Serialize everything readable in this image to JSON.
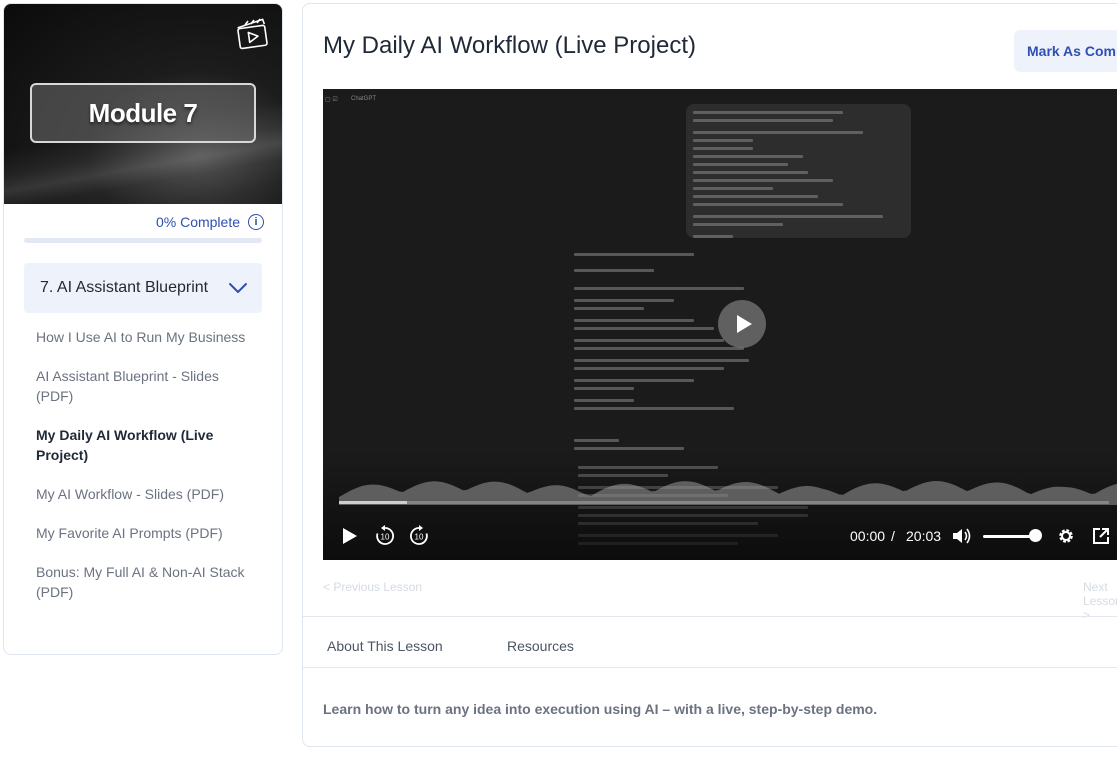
{
  "sidebar": {
    "module_title": "Module 7",
    "progress_label": "0% Complete",
    "progress_fraction": 0,
    "info_glyph": "i",
    "section_title": "7. AI Assistant Blueprint",
    "lessons": [
      "How I Use AI to Run My Business",
      "AI Assistant Blueprint - Slides (PDF)",
      "My Daily AI Workflow (Live Project)",
      "My AI Workflow - Slides (PDF)",
      "My Favorite AI Prompts (PDF)",
      "Bonus: My Full AI & Non-AI Stack (PDF)"
    ],
    "active_lesson_index": 2
  },
  "main": {
    "title": "My Daily AI Workflow (Live Project)",
    "mark_complete_label": "Mark As Complete",
    "video": {
      "app_label": "ChatGPT",
      "current_time": "00:00",
      "separator": "/",
      "duration": "20:03"
    },
    "prev_label": "< Previous Lesson",
    "next_label": "Next Lesson >",
    "tabs": [
      "About This Lesson",
      "Resources"
    ],
    "description": "Learn how to turn any idea into execution using AI – with a live, step-by-step demo."
  },
  "icons": {
    "module_badge": "video-clapper-icon",
    "progress_info": "info-icon",
    "section_toggle": "chevron-down-icon",
    "video_controls": [
      "play-icon",
      "rewind-10-icon",
      "forward-10-icon",
      "volume-icon",
      "settings-icon",
      "external-link-icon"
    ]
  },
  "colors": {
    "accent": "#2f4fb3",
    "section_bg": "#eef3fb",
    "video_bg": "#1b1b1b"
  }
}
